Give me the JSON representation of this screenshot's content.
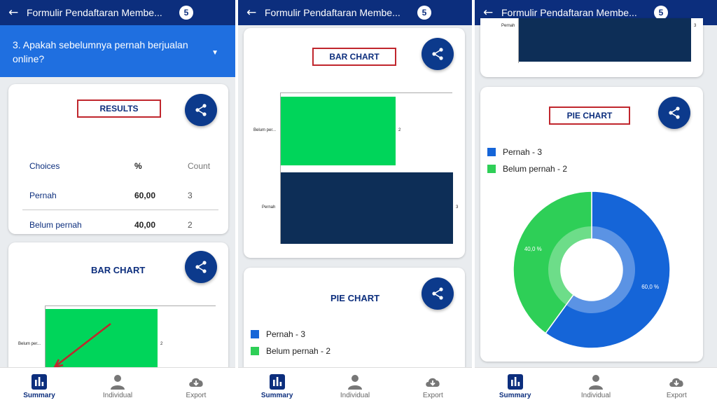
{
  "header": {
    "back_icon": "back-arrow-icon",
    "title": "Formulir Pendaftaran Membe...",
    "badge": "5"
  },
  "question": {
    "text": "3. Apakah sebelumnya pernah berjualan online?",
    "caret_icon": "dropdown-caret-icon"
  },
  "results": {
    "title": "RESULTS",
    "columns": {
      "choices": "Choices",
      "percent": "%",
      "count": "Count"
    },
    "rows": [
      {
        "choice": "Pernah",
        "percent": "60,00",
        "count": "3"
      },
      {
        "choice": "Belum pernah",
        "percent": "40,00",
        "count": "2"
      }
    ]
  },
  "bar_chart_title": "BAR CHART",
  "pie_chart_title": "PIE CHART",
  "share_icon": "share-icon",
  "chart_data": [
    {
      "type": "bar",
      "orientation": "horizontal",
      "title": "BAR CHART",
      "categories": [
        "Belum per...",
        "Pernah"
      ],
      "values": [
        2,
        3
      ],
      "colors": [
        "#00d55a",
        "#0d2e57"
      ],
      "xlim": [
        0,
        3
      ],
      "grid": false
    },
    {
      "type": "pie",
      "style": "donut",
      "title": "PIE CHART",
      "labels": [
        "Pernah",
        "Belum pernah"
      ],
      "legend": [
        "Pernah - 3",
        "Belum pernah - 2"
      ],
      "values": [
        3,
        2
      ],
      "slice_labels": [
        "60,0 %",
        "40,0 %"
      ],
      "colors": [
        "#1565d8",
        "#2ecf57"
      ],
      "legend_position": "top-left"
    }
  ],
  "nav": {
    "summary": {
      "label": "Summary",
      "icon": "bar-chart-icon"
    },
    "individual": {
      "label": "Individual",
      "icon": "person-icon"
    },
    "export": {
      "label": "Export",
      "icon": "cloud-download-icon"
    }
  },
  "colors": {
    "appbar": "#0c2e7d",
    "question_bar": "#1f6fe0",
    "highlight_box": "#c0262d",
    "fab": "#0c3a8c",
    "bar_green": "#00d55a",
    "bar_navy": "#0d2e57",
    "pie_blue": "#1565d8",
    "pie_green": "#2ecf57"
  }
}
